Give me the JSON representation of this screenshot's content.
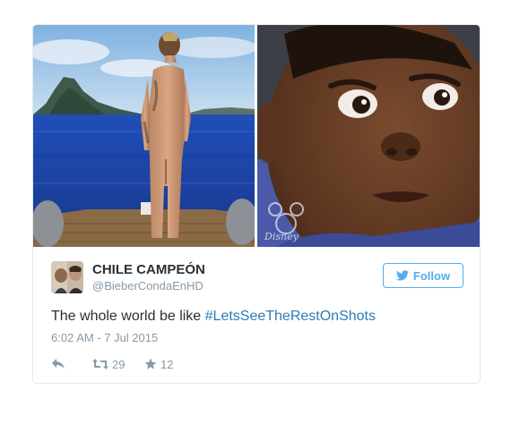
{
  "tweet": {
    "display_name": "CHILE CAMPEÓN",
    "handle": "@BieberCondaEnHD",
    "text_prefix": "The whole world be like ",
    "hashtag": "#LetsSeeTheRestOnShots",
    "timestamp": "6:02 AM - 7 Jul 2015",
    "follow_label": "Follow",
    "retweet_count": "29",
    "like_count": "12",
    "watermark_text": "Disney"
  },
  "icons": {
    "reply": "reply-icon",
    "retweet": "retweet-icon",
    "like": "star-icon",
    "follow": "twitter-bird-icon"
  },
  "colors": {
    "accent": "#55acee",
    "link": "#2b7bb9",
    "text": "#292f33",
    "muted": "#8899a6",
    "border": "#e1e8ed"
  }
}
